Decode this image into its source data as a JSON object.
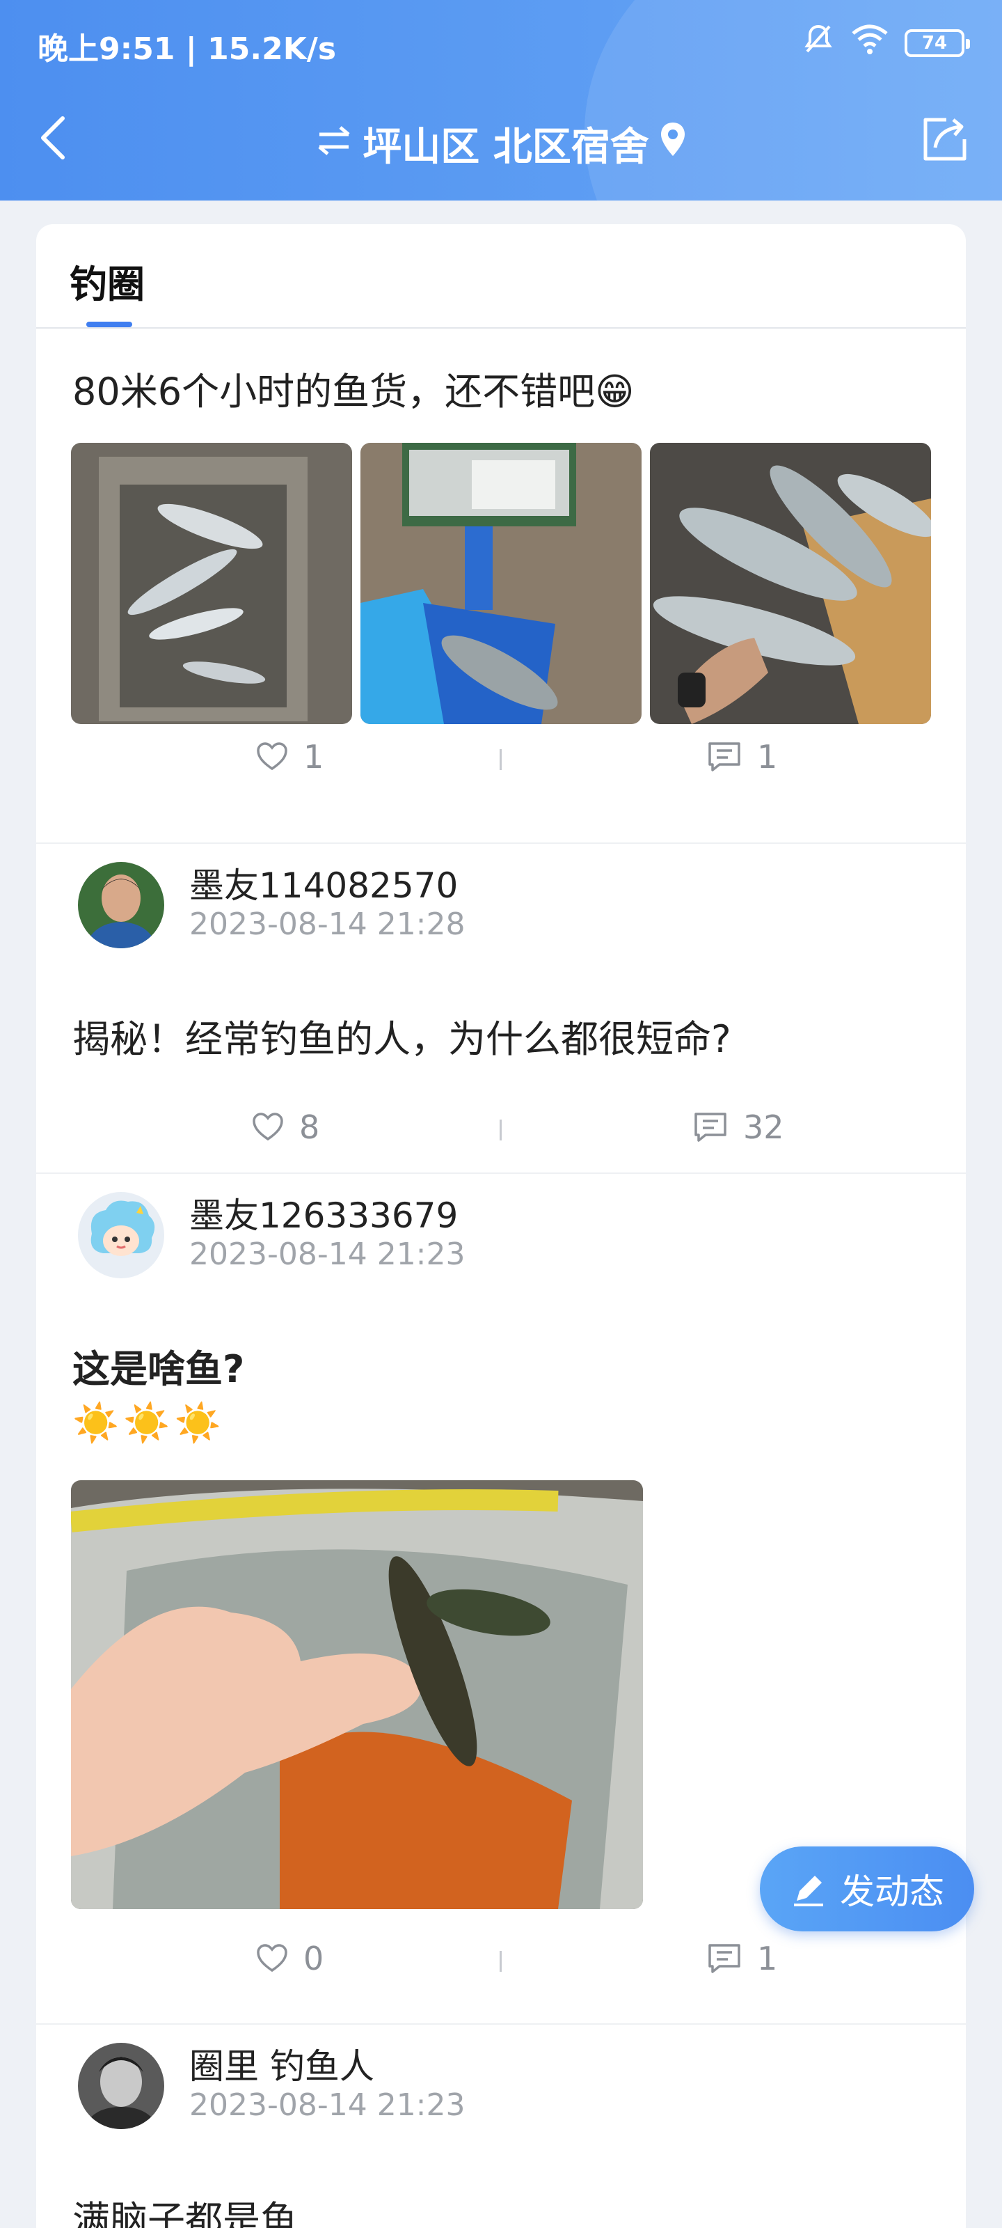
{
  "status_bar": {
    "time_speed": "晚上9:51 | 15.2K/s",
    "battery": "74",
    "icons": [
      "bell-mute-icon",
      "wifi-icon",
      "battery-icon"
    ]
  },
  "nav": {
    "location": "坪山区 北区宿舍",
    "icons": [
      "back-arrow-icon",
      "swap-icon",
      "location-pin-icon",
      "share-icon"
    ]
  },
  "tabs": [
    {
      "label": "钓圈",
      "active": true
    }
  ],
  "posts": [
    {
      "text": "80米6个小时的鱼货，还不错吧😁",
      "likes": "1",
      "comments": "1"
    },
    {
      "author": "墨友114082570",
      "time": "2023-08-14  21:28",
      "text": "揭秘！经常钓鱼的人，为什么都很短命?",
      "likes": "8",
      "comments": "32"
    },
    {
      "author": "墨友126333679",
      "time": "2023-08-14  21:23",
      "text": "这是啥鱼?",
      "emojis": "☀️☀️☀️",
      "likes": "0",
      "comments": "1"
    },
    {
      "author": "圈里 钓鱼人",
      "time": "2023-08-14  21:23",
      "text": "满脑子都是鱼"
    }
  ],
  "fab": {
    "label": "发动态"
  },
  "colors": {
    "header": "#4d8ff0",
    "accent": "#3f7ef0",
    "meta_text": "#a0a4aa"
  }
}
